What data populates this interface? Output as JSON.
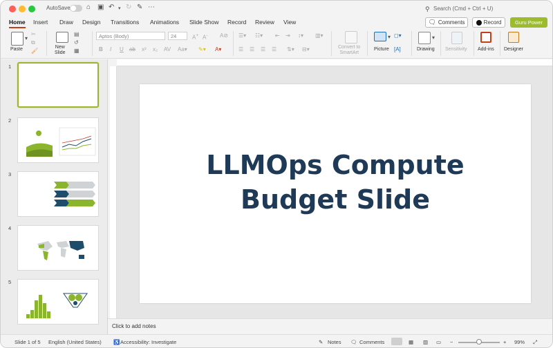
{
  "titlebar": {
    "autosave_label": "AutoSave",
    "search_placeholder": "Search (Cmd + Ctrl + U)"
  },
  "tabs": [
    "Home",
    "Insert",
    "Draw",
    "Design",
    "Transitions",
    "Animations",
    "Slide Show",
    "Record",
    "Review",
    "View"
  ],
  "tabs_active": "Home",
  "actions": {
    "comments_label": "Comments",
    "record_label": "Record",
    "guru_label": "Guru Power"
  },
  "ribbon": {
    "paste_label": "Paste",
    "new_slide_label": "New\nSlide",
    "font_name": "Aptos (Body)",
    "font_size": "24",
    "convert_smartart_label": "Convert to\nSmartArt",
    "picture_label": "Picture",
    "drawing_label": "Drawing",
    "sensitivity_label": "Sensitivity",
    "addins_label": "Add-ins",
    "designer_label": "Designer"
  },
  "slides": [
    {
      "number": "1",
      "selected": true
    },
    {
      "number": "2",
      "selected": false
    },
    {
      "number": "3",
      "selected": false
    },
    {
      "number": "4",
      "selected": false
    },
    {
      "number": "5",
      "selected": false
    }
  ],
  "slide": {
    "title_line1": "LLMOps Compute",
    "title_line2": "Budget Slide"
  },
  "notes_placeholder": "Click to add notes",
  "status": {
    "slide_count": "Slide 1 of 5",
    "language": "English (United States)",
    "accessibility": "Accessibility: Investigate",
    "notes_label": "Notes",
    "comments_label": "Comments",
    "zoom_percent": "99%",
    "zoom_level": 0.5
  },
  "colors": {
    "accent": "#c43e1c",
    "title_text": "#1e3a57",
    "guru_button": "#9cbb2e",
    "thumb_green": "#8bb52c",
    "thumb_navy": "#1e4c6b"
  }
}
